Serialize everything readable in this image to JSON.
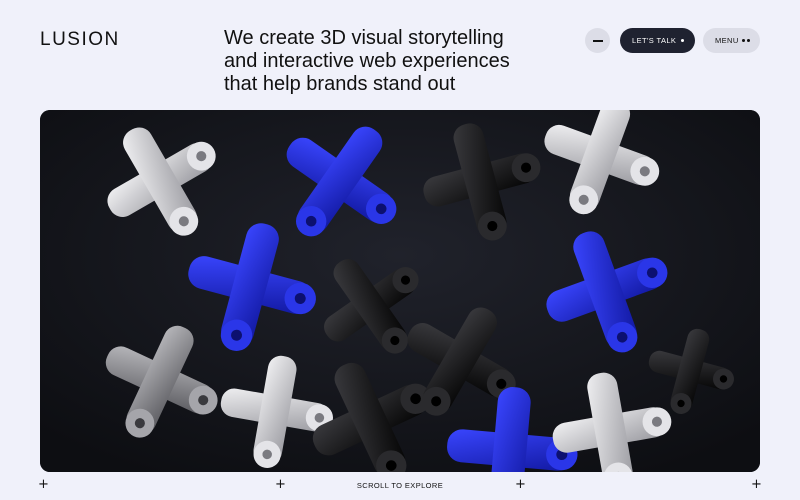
{
  "header": {
    "logo": "LUSION",
    "tagline": {
      "line1": "We create 3D visual storytelling",
      "line2": "and interactive web experiences",
      "line3": "that help brands stand out"
    },
    "minus_icon": "minus-icon",
    "talk_button": {
      "label": "LET'S TALK",
      "icon": "dot-icon"
    },
    "menu_button": {
      "label": "MENU",
      "icon": "two-dots-icon"
    }
  },
  "hero": {
    "description_icon": "3d-cross-shapes",
    "colors": {
      "background": "#111318",
      "blue": "#1f2bd6",
      "white": "#d9d9dc",
      "black": "#151515"
    }
  },
  "footer": {
    "scroll_label": "SCROLL TO EXPLORE",
    "plus_glyph": "+"
  },
  "colors": {
    "page_background": "#f0f1fa",
    "button_dark": "#1f2230",
    "button_light": "#dcdde7",
    "text": "#111111"
  }
}
